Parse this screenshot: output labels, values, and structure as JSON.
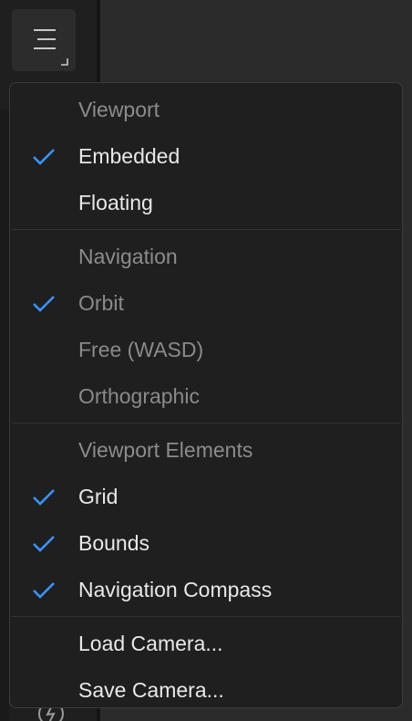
{
  "colors": {
    "accent_check": "#3794ff",
    "menu_background": "#1f1f1f",
    "text_primary": "#e8e8e8",
    "text_dimmed": "#8c8c8c"
  },
  "toolbar": {
    "menu_button_icon": "hamburger-menu-icon",
    "bottom_icon": "lightning-icon"
  },
  "menu": {
    "viewport": {
      "header": "Viewport",
      "items": [
        {
          "label": "Embedded",
          "checked": true,
          "enabled": true
        },
        {
          "label": "Floating",
          "checked": false,
          "enabled": true
        }
      ]
    },
    "navigation": {
      "header": "Navigation",
      "items": [
        {
          "label": "Orbit",
          "checked": true,
          "enabled": false
        },
        {
          "label": "Free (WASD)",
          "checked": false,
          "enabled": false
        },
        {
          "label": "Orthographic",
          "checked": false,
          "enabled": false
        }
      ]
    },
    "viewport_elements": {
      "header": "Viewport Elements",
      "items": [
        {
          "label": "Grid",
          "checked": true,
          "enabled": true
        },
        {
          "label": "Bounds",
          "checked": true,
          "enabled": true
        },
        {
          "label": "Navigation Compass",
          "checked": true,
          "enabled": true
        }
      ]
    },
    "camera": {
      "items": [
        {
          "label": "Load Camera...",
          "checked": false,
          "enabled": true
        },
        {
          "label": "Save Camera...",
          "checked": false,
          "enabled": true
        }
      ]
    }
  }
}
